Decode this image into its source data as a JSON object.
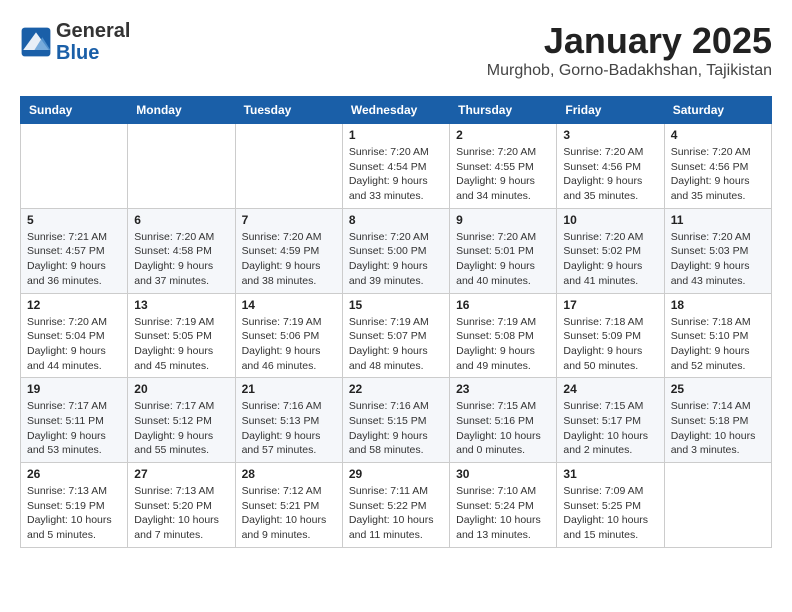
{
  "logo": {
    "general": "General",
    "blue": "Blue"
  },
  "title": "January 2025",
  "subtitle": "Murghob, Gorno-Badakhshan, Tajikistan",
  "days_of_week": [
    "Sunday",
    "Monday",
    "Tuesday",
    "Wednesday",
    "Thursday",
    "Friday",
    "Saturday"
  ],
  "weeks": [
    [
      {
        "day": "",
        "info": ""
      },
      {
        "day": "",
        "info": ""
      },
      {
        "day": "",
        "info": ""
      },
      {
        "day": "1",
        "info": "Sunrise: 7:20 AM\nSunset: 4:54 PM\nDaylight: 9 hours and 33 minutes."
      },
      {
        "day": "2",
        "info": "Sunrise: 7:20 AM\nSunset: 4:55 PM\nDaylight: 9 hours and 34 minutes."
      },
      {
        "day": "3",
        "info": "Sunrise: 7:20 AM\nSunset: 4:56 PM\nDaylight: 9 hours and 35 minutes."
      },
      {
        "day": "4",
        "info": "Sunrise: 7:20 AM\nSunset: 4:56 PM\nDaylight: 9 hours and 35 minutes."
      }
    ],
    [
      {
        "day": "5",
        "info": "Sunrise: 7:21 AM\nSunset: 4:57 PM\nDaylight: 9 hours and 36 minutes."
      },
      {
        "day": "6",
        "info": "Sunrise: 7:20 AM\nSunset: 4:58 PM\nDaylight: 9 hours and 37 minutes."
      },
      {
        "day": "7",
        "info": "Sunrise: 7:20 AM\nSunset: 4:59 PM\nDaylight: 9 hours and 38 minutes."
      },
      {
        "day": "8",
        "info": "Sunrise: 7:20 AM\nSunset: 5:00 PM\nDaylight: 9 hours and 39 minutes."
      },
      {
        "day": "9",
        "info": "Sunrise: 7:20 AM\nSunset: 5:01 PM\nDaylight: 9 hours and 40 minutes."
      },
      {
        "day": "10",
        "info": "Sunrise: 7:20 AM\nSunset: 5:02 PM\nDaylight: 9 hours and 41 minutes."
      },
      {
        "day": "11",
        "info": "Sunrise: 7:20 AM\nSunset: 5:03 PM\nDaylight: 9 hours and 43 minutes."
      }
    ],
    [
      {
        "day": "12",
        "info": "Sunrise: 7:20 AM\nSunset: 5:04 PM\nDaylight: 9 hours and 44 minutes."
      },
      {
        "day": "13",
        "info": "Sunrise: 7:19 AM\nSunset: 5:05 PM\nDaylight: 9 hours and 45 minutes."
      },
      {
        "day": "14",
        "info": "Sunrise: 7:19 AM\nSunset: 5:06 PM\nDaylight: 9 hours and 46 minutes."
      },
      {
        "day": "15",
        "info": "Sunrise: 7:19 AM\nSunset: 5:07 PM\nDaylight: 9 hours and 48 minutes."
      },
      {
        "day": "16",
        "info": "Sunrise: 7:19 AM\nSunset: 5:08 PM\nDaylight: 9 hours and 49 minutes."
      },
      {
        "day": "17",
        "info": "Sunrise: 7:18 AM\nSunset: 5:09 PM\nDaylight: 9 hours and 50 minutes."
      },
      {
        "day": "18",
        "info": "Sunrise: 7:18 AM\nSunset: 5:10 PM\nDaylight: 9 hours and 52 minutes."
      }
    ],
    [
      {
        "day": "19",
        "info": "Sunrise: 7:17 AM\nSunset: 5:11 PM\nDaylight: 9 hours and 53 minutes."
      },
      {
        "day": "20",
        "info": "Sunrise: 7:17 AM\nSunset: 5:12 PM\nDaylight: 9 hours and 55 minutes."
      },
      {
        "day": "21",
        "info": "Sunrise: 7:16 AM\nSunset: 5:13 PM\nDaylight: 9 hours and 57 minutes."
      },
      {
        "day": "22",
        "info": "Sunrise: 7:16 AM\nSunset: 5:15 PM\nDaylight: 9 hours and 58 minutes."
      },
      {
        "day": "23",
        "info": "Sunrise: 7:15 AM\nSunset: 5:16 PM\nDaylight: 10 hours and 0 minutes."
      },
      {
        "day": "24",
        "info": "Sunrise: 7:15 AM\nSunset: 5:17 PM\nDaylight: 10 hours and 2 minutes."
      },
      {
        "day": "25",
        "info": "Sunrise: 7:14 AM\nSunset: 5:18 PM\nDaylight: 10 hours and 3 minutes."
      }
    ],
    [
      {
        "day": "26",
        "info": "Sunrise: 7:13 AM\nSunset: 5:19 PM\nDaylight: 10 hours and 5 minutes."
      },
      {
        "day": "27",
        "info": "Sunrise: 7:13 AM\nSunset: 5:20 PM\nDaylight: 10 hours and 7 minutes."
      },
      {
        "day": "28",
        "info": "Sunrise: 7:12 AM\nSunset: 5:21 PM\nDaylight: 10 hours and 9 minutes."
      },
      {
        "day": "29",
        "info": "Sunrise: 7:11 AM\nSunset: 5:22 PM\nDaylight: 10 hours and 11 minutes."
      },
      {
        "day": "30",
        "info": "Sunrise: 7:10 AM\nSunset: 5:24 PM\nDaylight: 10 hours and 13 minutes."
      },
      {
        "day": "31",
        "info": "Sunrise: 7:09 AM\nSunset: 5:25 PM\nDaylight: 10 hours and 15 minutes."
      },
      {
        "day": "",
        "info": ""
      }
    ]
  ]
}
